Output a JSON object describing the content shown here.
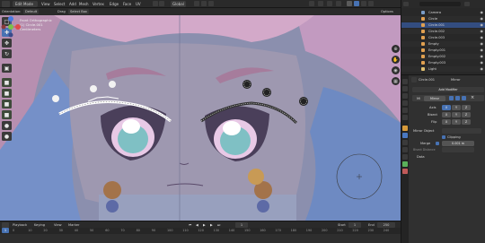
{
  "header": {
    "mode": "Edit Mode",
    "menus": [
      "View",
      "Select",
      "Add",
      "Mesh",
      "Vertex",
      "Edge",
      "Face",
      "UV"
    ],
    "transform_orientation": "Global"
  },
  "subbar": {
    "orientation_label": "Orientation:",
    "orientation_value": "Default",
    "drag_label": "Drag",
    "drag_value": "Select Box",
    "options_label": "Options"
  },
  "viewport": {
    "info_line1": "Front Orthographic",
    "info_line2": "(1) Circle.001",
    "info_line3": "Centimeters"
  },
  "timeline": {
    "menus": [
      "Playback",
      "Keying",
      "View",
      "Marker"
    ],
    "start_label": "Start",
    "start_value": "1",
    "end_label": "End",
    "end_value": "250",
    "current_frame": "1",
    "ticks": [
      "0",
      "10",
      "20",
      "30",
      "40",
      "50",
      "60",
      "70",
      "80",
      "90",
      "100",
      "110",
      "120",
      "130",
      "140",
      "150",
      "160",
      "170",
      "180",
      "190",
      "200",
      "210",
      "220",
      "230",
      "240"
    ]
  },
  "outliner": {
    "items": [
      {
        "name": "Camera",
        "color": "#7a9cc6"
      },
      {
        "name": "Circle",
        "color": "#e0a050"
      },
      {
        "name": "Circle.001",
        "color": "#e0a050"
      },
      {
        "name": "Circle.002",
        "color": "#e0a050"
      },
      {
        "name": "Circle.003",
        "color": "#e0a050"
      },
      {
        "name": "Empty",
        "color": "#e0a050"
      },
      {
        "name": "Empty.001",
        "color": "#e0a050"
      },
      {
        "name": "Empty.002",
        "color": "#e0a050"
      },
      {
        "name": "Empty.003",
        "color": "#e0a050"
      },
      {
        "name": "Light",
        "color": "#e0c070"
      }
    ]
  },
  "properties": {
    "object_name": "Circle.001",
    "modifier_name": "Mirror",
    "add_modifier": "Add Modifier",
    "mod_short": "Mi",
    "axis_label": "Axis",
    "bisect_label": "Bisect",
    "flip_label": "Flip",
    "mirror_object_label": "Mirror Object",
    "clipping_label": "Clipping",
    "merge_label": "Merge",
    "merge_value": "0.001 m",
    "bisect_distance_label": "Bisect Distance",
    "data_label": "Data"
  }
}
